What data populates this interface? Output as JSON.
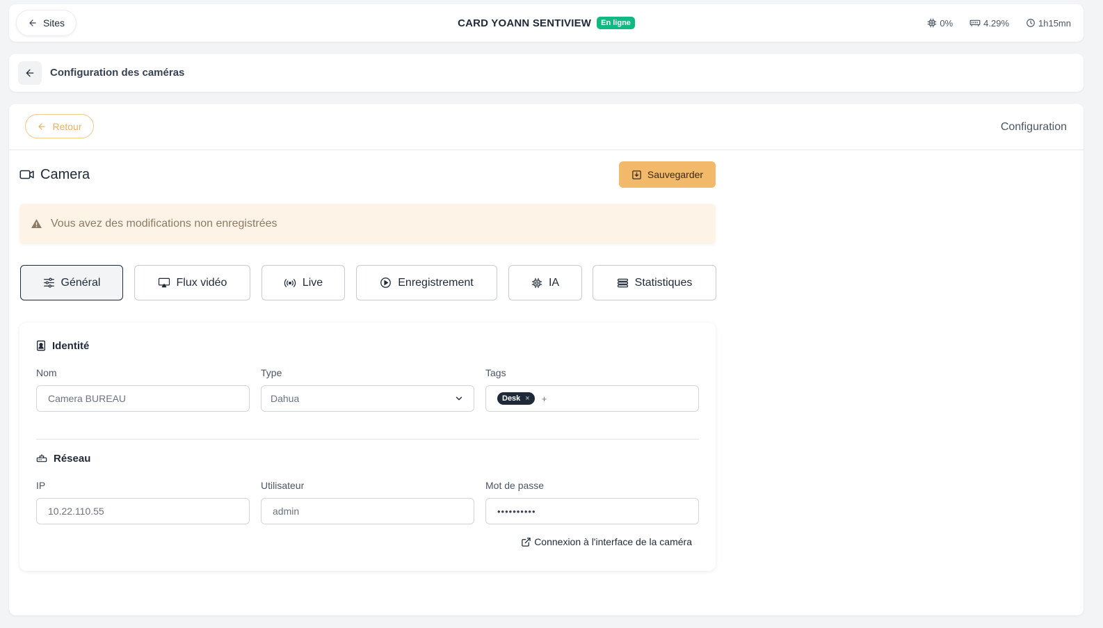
{
  "topbar": {
    "sites_label": "Sites",
    "site_name": "CARD YOANN SENTIVIEW",
    "status_badge": "En ligne",
    "stats": [
      {
        "icon": "cpu-icon",
        "value": "0%"
      },
      {
        "icon": "memory-icon",
        "value": "4.29%"
      },
      {
        "icon": "clock-icon",
        "value": "1h15mn"
      }
    ]
  },
  "breadcrumb": {
    "title": "Configuration des caméras"
  },
  "main": {
    "back_label": "Retour",
    "header_label": "Configuration",
    "camera_title": "Camera",
    "save_label": "Sauvegarder",
    "warning": "Vous avez des modifications non enregistrées",
    "tabs": [
      {
        "label": "Général",
        "icon": "sliders-icon",
        "active": true
      },
      {
        "label": "Flux vidéo",
        "icon": "screen-icon",
        "active": false
      },
      {
        "label": "Live",
        "icon": "broadcast-icon",
        "active": false
      },
      {
        "label": "Enregistrement",
        "icon": "play-circle-icon",
        "active": false
      },
      {
        "label": "IA",
        "icon": "chip-icon",
        "active": false
      },
      {
        "label": "Statistiques",
        "icon": "list-icon",
        "active": false
      }
    ]
  },
  "identity": {
    "title": "Identité",
    "name_label": "Nom",
    "name_value": "Camera BUREAU",
    "type_label": "Type",
    "type_value": "Dahua",
    "tags_label": "Tags",
    "tags": [
      "Desk"
    ],
    "tag_remove": "×",
    "tag_add": "+"
  },
  "network": {
    "title": "Réseau",
    "ip_label": "IP",
    "ip_value": "10.22.110.55",
    "user_label": "Utilisateur",
    "user_value": "admin",
    "password_label": "Mot de passe",
    "password_value": "••••••••••",
    "connect_label": "Connexion à l'interface de la caméra"
  },
  "colors": {
    "accent": "#f1b969",
    "online": "#10b981",
    "warning_bg": "#fdf3e6"
  }
}
